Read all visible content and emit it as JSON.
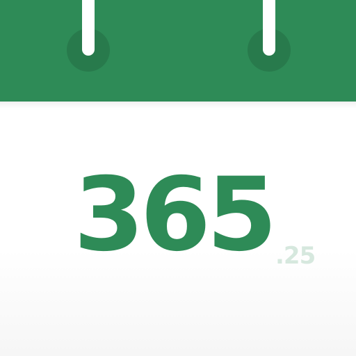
{
  "calendar_icon": {
    "number": "365",
    "fraction": ".25",
    "colors": {
      "header": "#2e8b57",
      "ring_hole": "#287a4c",
      "ring": "#ffffff",
      "number": "#2e8b57",
      "fraction": "#d6e8de",
      "page": "#ffffff"
    },
    "icons": [
      "calendar-icon",
      "binder-ring-icon"
    ]
  }
}
